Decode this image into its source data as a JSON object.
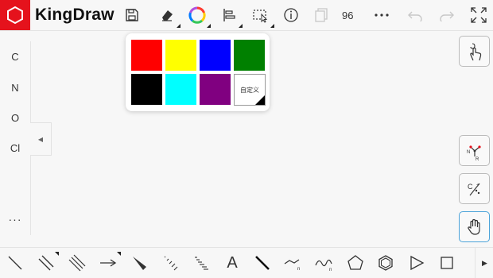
{
  "app": {
    "name": "KingDraw"
  },
  "toolbar": {
    "zoom": "96",
    "icons": [
      "save-icon",
      "eraser-icon",
      "color-wheel-icon",
      "align-icon",
      "select-icon",
      "info-icon",
      "copy-icon",
      "more-icon",
      "undo-icon",
      "redo-icon",
      "fullscreen-icon"
    ]
  },
  "left_panel": {
    "atoms": [
      "C",
      "N",
      "O",
      "Cl"
    ],
    "more": "···"
  },
  "color_popup": {
    "colors": [
      "#ff0000",
      "#ffff00",
      "#0000ff",
      "#008000",
      "#000000",
      "#00ffff",
      "#800080"
    ],
    "custom_label": "自定义"
  },
  "bottom_tools": {
    "atom_text": "A",
    "icons": [
      "single-bond-icon",
      "double-bond-icon",
      "triple-bond-icon",
      "arrow-icon",
      "wedge-bond-icon",
      "hashed-wedge-icon",
      "wavy-bond-icon",
      "text-icon",
      "bold-bond-icon",
      "chain-icon",
      "curved-arrow-icon",
      "cyclopentane-icon",
      "benzene-icon",
      "triangle-icon",
      "square-icon"
    ]
  },
  "right_tools": {
    "icons": [
      "touch-draw-icon",
      "template-icon",
      "charge-icon",
      "hand-icon"
    ]
  }
}
